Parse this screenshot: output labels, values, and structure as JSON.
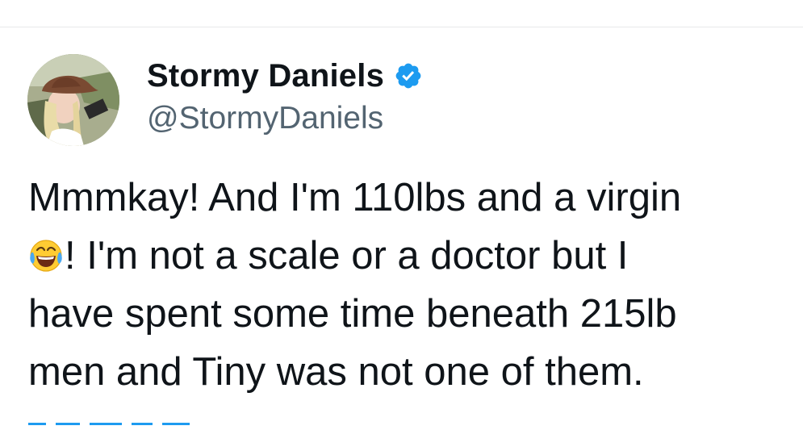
{
  "author": {
    "display_name": "Stormy Daniels",
    "handle": "@StormyDaniels",
    "verified": true,
    "verified_icon": "verified-badge-icon",
    "avatar_icon": "profile-photo"
  },
  "tweet": {
    "lines": [
      "Mmmkay! And I'm 110lbs and a virgin",
      "! I'm not a scale or a doctor but I",
      "have spent some time beneath 215lb",
      "men and Tiny was not one of them."
    ],
    "emoji": "face-with-tears-of-joy-icon"
  },
  "colors": {
    "text": "#0f1419",
    "handle": "#536471",
    "accent": "#1d9bf0",
    "divider": "#e7e9ea"
  }
}
